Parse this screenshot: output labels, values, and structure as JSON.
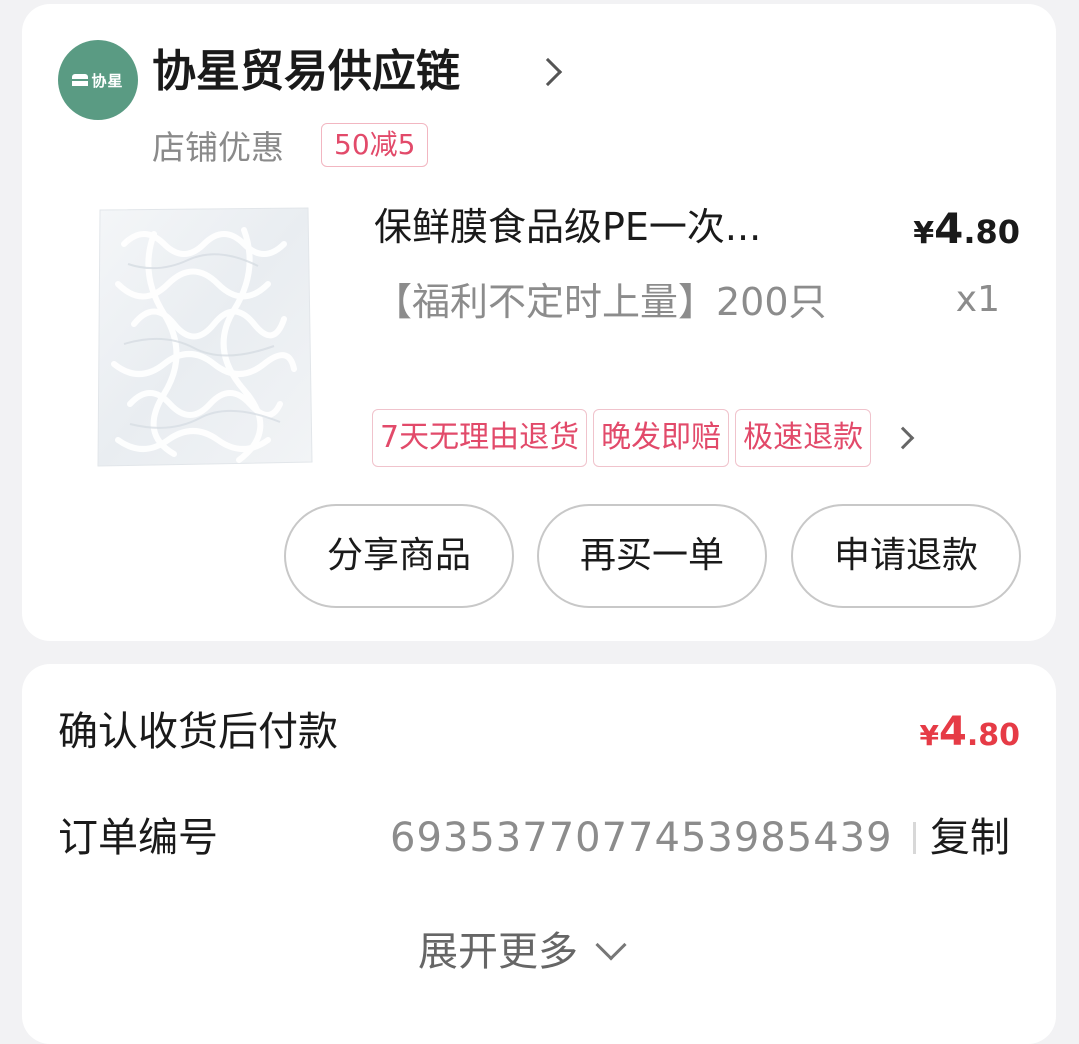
{
  "shop": {
    "logo_text": "协星",
    "name": "协星贸易供应链",
    "promo_label": "店铺优惠",
    "promo_badge": "50减5"
  },
  "product": {
    "title": "保鲜膜食品级PE一次...",
    "price_symbol": "¥",
    "price_int": "4",
    "price_dec": ".80",
    "spec": "【福利不定时上量】200只",
    "quantity": "x1",
    "tags": [
      "7天无理由退货",
      "晚发即赔",
      "极速退款"
    ]
  },
  "actions": {
    "share": "分享商品",
    "rebuy": "再买一单",
    "refund": "申请退款"
  },
  "order": {
    "pay_label": "确认收货后付款",
    "pay_symbol": "¥",
    "pay_int": "4",
    "pay_dec": ".80",
    "order_no_label": "订单编号",
    "order_no": "6935377077453985439",
    "copy_label": "复制",
    "expand_label": "展开更多"
  },
  "colors": {
    "accent_red": "#e63b46",
    "tag_pink": "#e24a6a",
    "logo_green": "#5a9b83"
  }
}
